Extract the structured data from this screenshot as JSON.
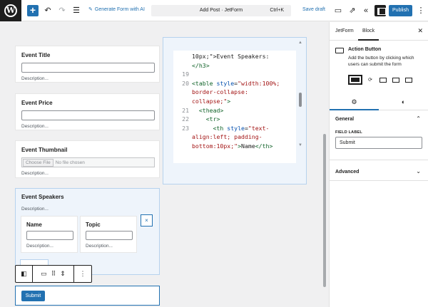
{
  "topbar": {
    "generate_ai_label": "Generate Form with AI",
    "doc_title": "Add Post · JetForm",
    "shortcut": "Ctrl+K",
    "save_draft": "Save draft",
    "publish": "Publish"
  },
  "fields": [
    {
      "label": "Event Title",
      "description": "Description..."
    },
    {
      "label": "Event Price",
      "description": "Description..."
    },
    {
      "label": "Event Thumbnail",
      "description": "Description...",
      "choose_file": "Choose File",
      "no_file": "No file chosen"
    }
  ],
  "repeater": {
    "label": "Event Speakers",
    "description": "Description...",
    "columns": [
      {
        "label": "Name",
        "description": "Description..."
      },
      {
        "label": "Topic",
        "description": "Description..."
      }
    ],
    "remove_symbol": "×"
  },
  "submit": {
    "label": "Submit"
  },
  "code": {
    "lines": [
      {
        "num": "",
        "parts": [
          [
            "txt",
            "10px;\">Event Speakers:"
          ]
        ]
      },
      {
        "num": "",
        "parts": [
          [
            "tag",
            "</h3>"
          ]
        ]
      },
      {
        "num": "19",
        "parts": []
      },
      {
        "num": "20",
        "parts": [
          [
            "tag",
            "<table "
          ],
          [
            "attr",
            "style"
          ],
          [
            "txt",
            "="
          ],
          [
            "str",
            "\"width:100%;"
          ]
        ]
      },
      {
        "num": "",
        "parts": [
          [
            "str",
            "border-collapse:"
          ]
        ]
      },
      {
        "num": "",
        "parts": [
          [
            "str",
            "collapse;\""
          ],
          [
            "tag",
            ">"
          ]
        ]
      },
      {
        "num": "21",
        "parts": [
          [
            "tag",
            "  <thead>"
          ]
        ]
      },
      {
        "num": "22",
        "parts": [
          [
            "tag",
            "    <tr>"
          ]
        ]
      },
      {
        "num": "23",
        "parts": [
          [
            "tag",
            "      <th "
          ],
          [
            "attr",
            "style"
          ],
          [
            "txt",
            "="
          ],
          [
            "str",
            "\"text-"
          ]
        ]
      },
      {
        "num": "",
        "parts": [
          [
            "str",
            "align:left; padding-"
          ]
        ]
      },
      {
        "num": "",
        "parts": [
          [
            "str",
            "bottom:10px;\""
          ],
          [
            "tag",
            ">"
          ],
          [
            "txt",
            "Name"
          ],
          [
            "tag",
            "</th>"
          ]
        ]
      }
    ]
  },
  "sidebar": {
    "tab_jetform": "JetForm",
    "tab_block": "Block",
    "block_title": "Action Button",
    "block_desc": "Add the button by clicking which users can submit the form",
    "general": "General",
    "field_label_caption": "FIELD LABEL",
    "field_label_value": "Submit",
    "advanced": "Advanced"
  }
}
